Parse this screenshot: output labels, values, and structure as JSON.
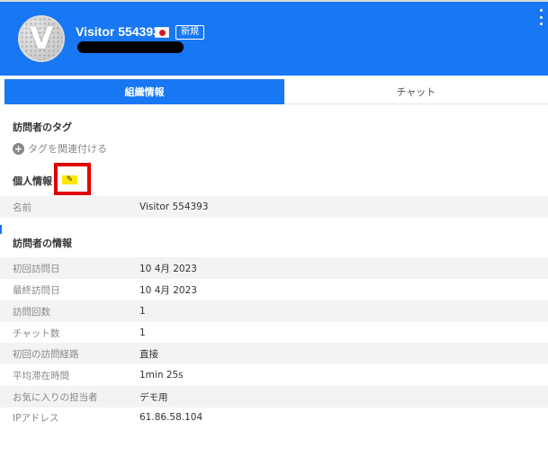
{
  "header": {
    "avatar_letter": "V",
    "visitor_name": "Visitor 554393",
    "new_badge": "新規",
    "colors": {
      "header_bg": "#1877f2",
      "flag_red": "#d71920"
    }
  },
  "tabs": [
    {
      "label": "組織情報",
      "active": true
    },
    {
      "label": "チャット",
      "active": false
    }
  ],
  "tags_section": {
    "title": "訪問者のタグ",
    "add_tag_label": "タグを関連付ける"
  },
  "personal_section": {
    "title": "個人情報",
    "rows": [
      {
        "label": "名前",
        "value": "Visitor 554393"
      }
    ]
  },
  "visitor_info_section": {
    "title": "訪問者の情報",
    "rows": [
      {
        "label": "初回訪問日",
        "value": "10 4月 2023"
      },
      {
        "label": "最終訪問日",
        "value": "10 4月 2023"
      },
      {
        "label": "訪問回数",
        "value": "1"
      },
      {
        "label": "チャット数",
        "value": "1"
      },
      {
        "label": "初回の訪問経路",
        "value": "直接"
      },
      {
        "label": "平均滞在時間",
        "value": "1min 25s"
      },
      {
        "label": "お気に入りの担当者",
        "value": "デモ用"
      },
      {
        "label": "IPアドレス",
        "value": "61.86.58.104"
      }
    ]
  },
  "icons": [
    "plus-circle-icon",
    "pencil-icon",
    "kebab-menu-icon",
    "japan-flag-icon"
  ]
}
